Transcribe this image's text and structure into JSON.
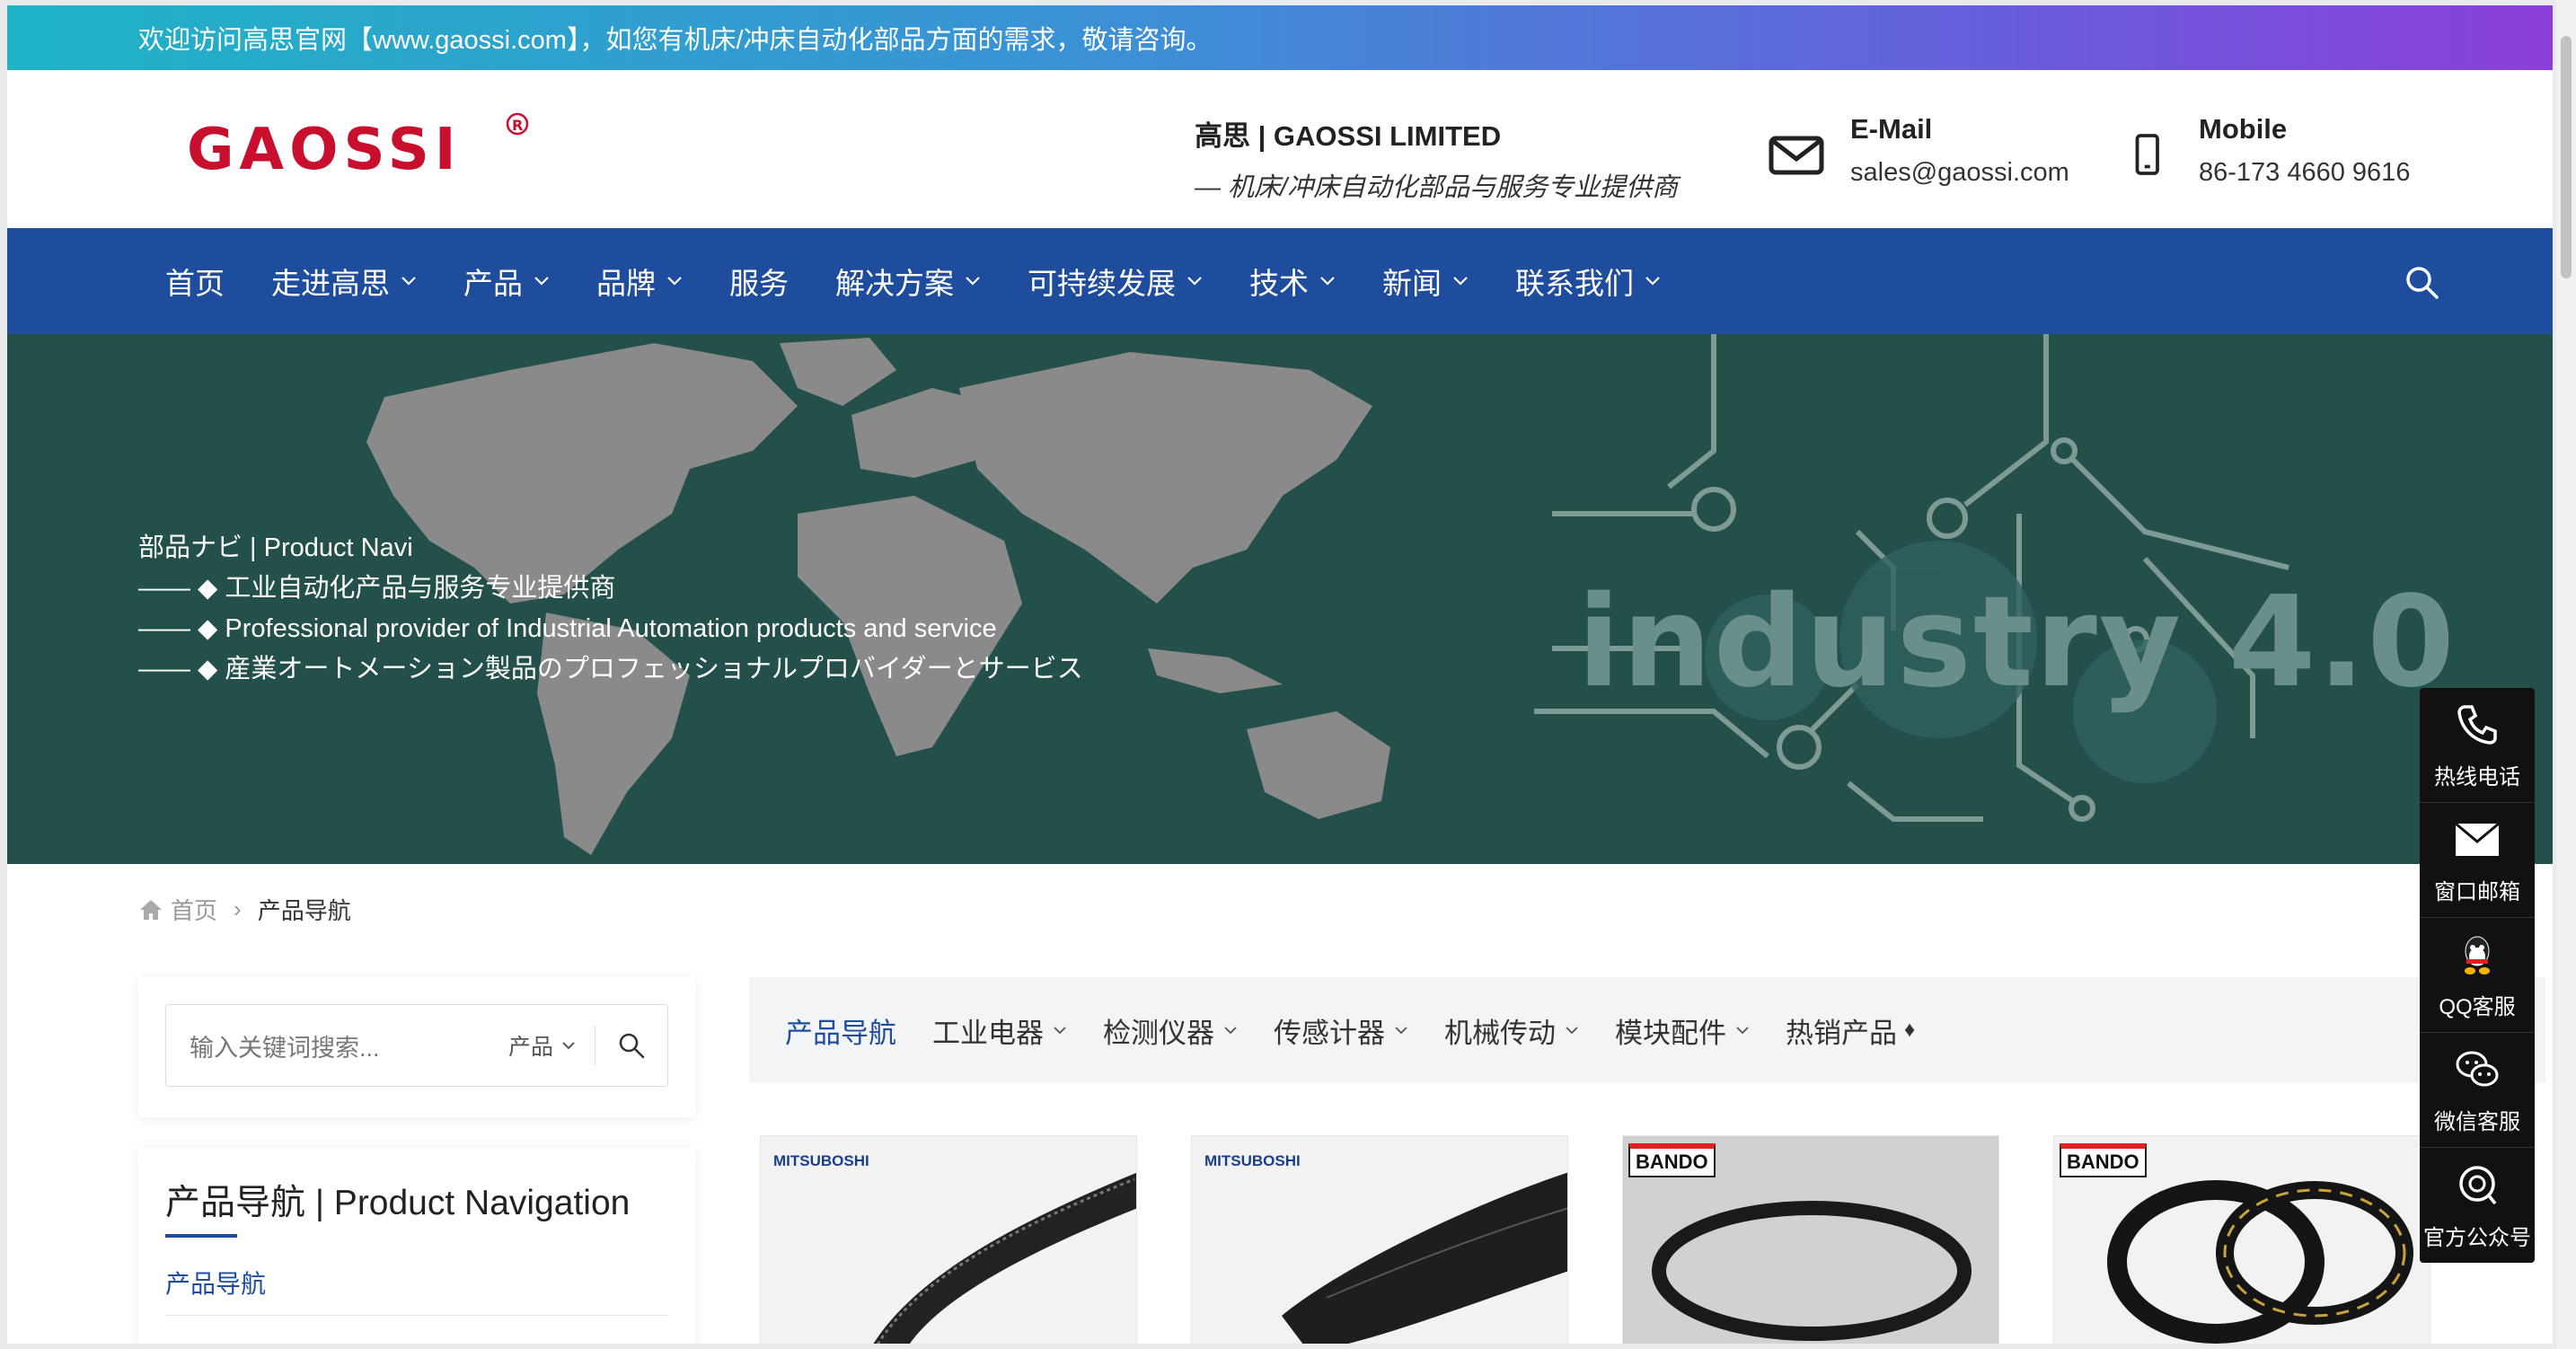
{
  "topbar": {
    "text": "欢迎访问高思官网【www.gaossi.com】，如您有机床/冲床自动化部品方面的需求，敬请咨询。"
  },
  "header": {
    "logo_text": "GAOSSI",
    "company_name": "高思 | GAOSSI LIMITED",
    "slogan": "— 机床/冲床自动化部品与服务专业提供商",
    "email_label": "E-Mail",
    "email_value": "sales@gaossi.com",
    "mobile_label": "Mobile",
    "mobile_value": "86-173 4660 9616"
  },
  "nav": {
    "items": [
      {
        "label": "首页",
        "dropdown": false
      },
      {
        "label": "走进高思",
        "dropdown": true
      },
      {
        "label": "产品",
        "dropdown": true
      },
      {
        "label": "品牌",
        "dropdown": true
      },
      {
        "label": "服务",
        "dropdown": false
      },
      {
        "label": "解决方案",
        "dropdown": true
      },
      {
        "label": "可持续发展",
        "dropdown": true
      },
      {
        "label": "技术",
        "dropdown": true
      },
      {
        "label": "新闻",
        "dropdown": true
      },
      {
        "label": "联系我们",
        "dropdown": true
      }
    ]
  },
  "banner": {
    "heading": "部品ナビ | Product Navi",
    "line1": "—— ◆ 工业自动化产品与服务专业提供商",
    "line2": "—— ◆ Professional provider of Industrial Automation products and service",
    "line3": "—— ◆ 産業オートメーション製品のプロフェッショナルプロバイダーとサービス",
    "industry_text": "industry 4.0"
  },
  "breadcrumb": {
    "home": "首页",
    "current": "产品导航"
  },
  "sidebar": {
    "search_placeholder": "输入关键词搜索...",
    "search_category": "产品",
    "nav_title": "产品导航 | Product Navigation",
    "nav_link": "产品导航"
  },
  "tabs": [
    {
      "label": "产品导航",
      "active": true,
      "dropdown": false
    },
    {
      "label": "工业电器",
      "active": false,
      "dropdown": true
    },
    {
      "label": "检测仪器",
      "active": false,
      "dropdown": true
    },
    {
      "label": "传感计器",
      "active": false,
      "dropdown": true
    },
    {
      "label": "机械传动",
      "active": false,
      "dropdown": true
    },
    {
      "label": "模块配件",
      "active": false,
      "dropdown": true
    },
    {
      "label": "热销产品",
      "active": false,
      "dropdown": false
    }
  ],
  "hot_marker": "♦",
  "products": [
    {
      "brand": "MITSUBOSHI"
    },
    {
      "brand": "MITSUBOSHI"
    },
    {
      "brand": "BANDO"
    },
    {
      "brand": "BANDO"
    }
  ],
  "float_toolbar": [
    {
      "label": "热线电话",
      "icon": "phone-icon"
    },
    {
      "label": "窗口邮箱",
      "icon": "mail-icon"
    },
    {
      "label": "QQ客服",
      "icon": "qq-icon"
    },
    {
      "label": "微信客服",
      "icon": "wechat-icon"
    },
    {
      "label": "官方公众号",
      "icon": "official-account-icon"
    }
  ],
  "colors": {
    "nav_blue": "#1e4d9e",
    "banner_green": "#24504c",
    "logo_red": "#c8102e"
  }
}
